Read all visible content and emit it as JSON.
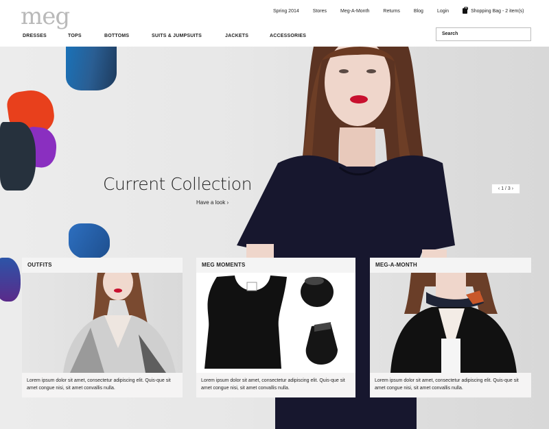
{
  "brand": {
    "logo": "meg"
  },
  "topnav": {
    "items": [
      "Spring 2014",
      "Stores",
      "Meg-A-Month",
      "Returns",
      "Blog",
      "Login"
    ],
    "bag_label": "Shopping Bag  -  2 item(s)"
  },
  "mainnav": {
    "items": [
      "DRESSES",
      "TOPS",
      "BOTTOMS",
      "SUITS & JUMPSUITS",
      "JACKETS",
      "ACCESSORIES"
    ]
  },
  "search": {
    "placeholder": "Search"
  },
  "hero": {
    "title": "Current Collection",
    "link": "Have a look",
    "slider": "1 / 3"
  },
  "cards": [
    {
      "title": "OUTFITS",
      "text": "Lorem ipsum dolor sit amet, consectetur adipiscing elit. Quis-que sit amet congue nisi, sit amet convallis nulla."
    },
    {
      "title": "MEG MOMENTS",
      "text": "Lorem ipsum dolor sit amet, consectetur adipiscing elit. Quis-que sit amet congue nisi, sit amet convallis nulla."
    },
    {
      "title": "MEG-A-MONTH",
      "text": "Lorem ipsum dolor sit amet, consectetur adipiscing elit. Quis-que sit amet congue nisi, sit amet convallis nulla."
    }
  ],
  "colors": {
    "logo": "#b9b9b9",
    "dress": "#17172e",
    "lips": "#c8102e"
  }
}
